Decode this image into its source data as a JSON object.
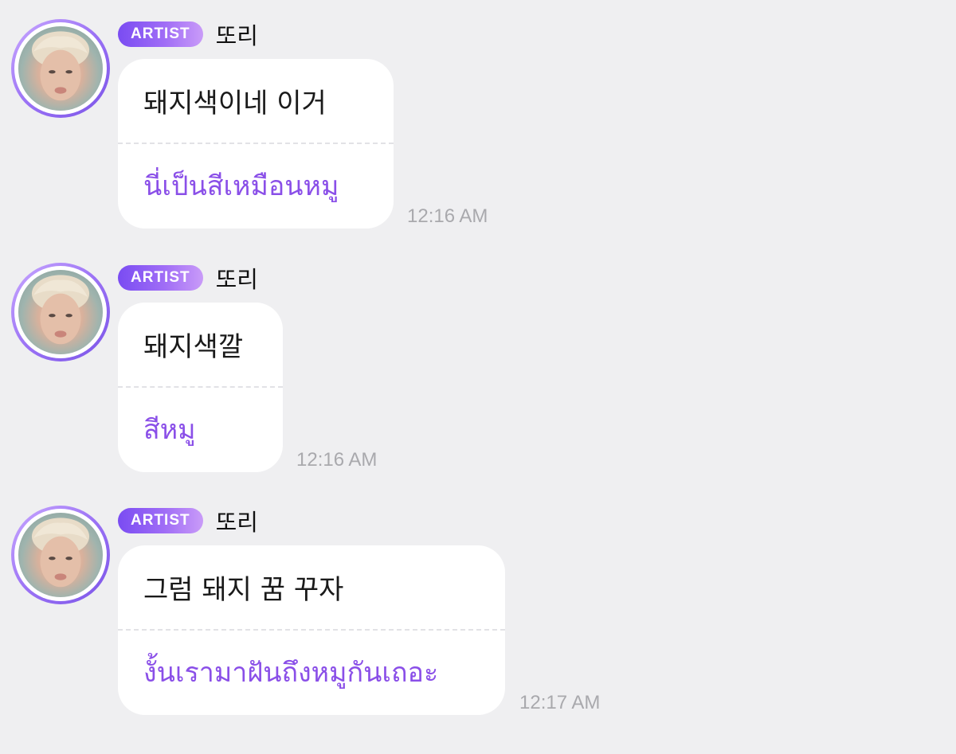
{
  "messages": [
    {
      "badge": "ARTIST",
      "sender": "또리",
      "text": "돼지색이네 이거",
      "translation": "นี่เป็นสีเหมือนหมู",
      "time": "12:16 AM"
    },
    {
      "badge": "ARTIST",
      "sender": "또리",
      "text": "돼지색깔",
      "translation": "สีหมู",
      "time": "12:16 AM"
    },
    {
      "badge": "ARTIST",
      "sender": "또리",
      "text": "그럼 돼지 꿈 꾸자",
      "translation": "งั้นเรามาฝันถึงหมูกันเถอะ",
      "time": "12:17 AM"
    }
  ],
  "colors": {
    "background": "#efeff1",
    "badge_start": "#7a4cf2",
    "badge_end": "#c99bf8",
    "translation": "#8a4fe8",
    "timestamp": "#a9a9ad"
  }
}
